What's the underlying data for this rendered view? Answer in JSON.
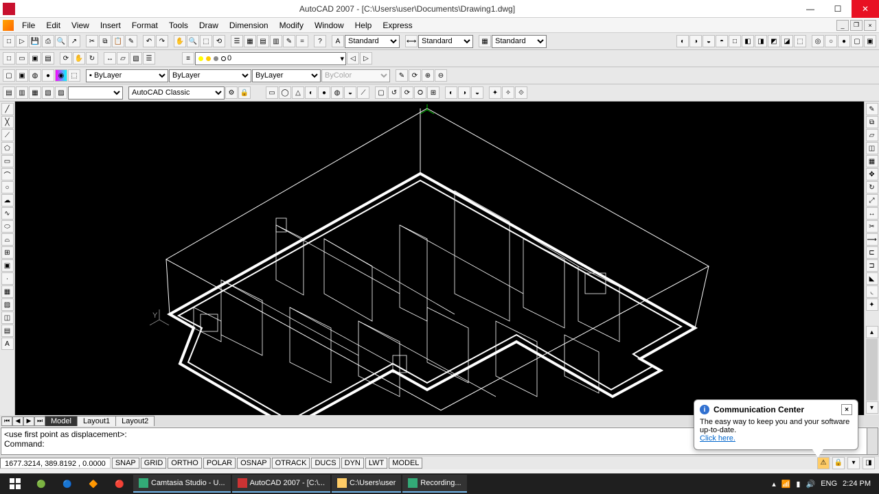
{
  "titlebar": {
    "title": "AutoCAD 2007 - [C:\\Users\\user\\Documents\\Drawing1.dwg]"
  },
  "menu": {
    "items": [
      "File",
      "Edit",
      "View",
      "Insert",
      "Format",
      "Tools",
      "Draw",
      "Dimension",
      "Modify",
      "Window",
      "Help",
      "Express"
    ]
  },
  "toolbar": {
    "textstyle": "Standard",
    "dimstyle": "Standard",
    "tablestyle": "Standard",
    "layer_current": "0",
    "linetype": "ByLayer",
    "lineweight": "ByLayer",
    "plotstyle": "ByColor",
    "workspace": "AutoCAD Classic"
  },
  "tabs": {
    "active": "Model",
    "others": [
      "Layout1",
      "Layout2"
    ]
  },
  "command": {
    "line1": "<use first point as displacement>:",
    "line2_label": "Command:"
  },
  "statusbar": {
    "coords": "1677.3214, 389.8192 , 0.0000",
    "toggles": [
      "SNAP",
      "GRID",
      "ORTHO",
      "POLAR",
      "OSNAP",
      "OTRACK",
      "DUCS",
      "DYN",
      "LWT",
      "MODEL"
    ]
  },
  "popup": {
    "title": "Communication Center",
    "body": "The easy way to keep you and your software up-to-date.",
    "link": "Click here."
  },
  "taskbar": {
    "apps": [
      {
        "label": "Camtasia Studio - U...",
        "icon": "#3a7"
      },
      {
        "label": "AutoCAD 2007 - [C:\\...",
        "icon": "#c33"
      },
      {
        "label": "C:\\Users\\user",
        "icon": "#fc6"
      },
      {
        "label": "Recording...",
        "icon": "#3a7"
      }
    ],
    "lang": "ENG",
    "time": "2:24 PM"
  },
  "canvas": {
    "axis_y": "Y"
  },
  "colors": {
    "accent": "#e81123"
  }
}
